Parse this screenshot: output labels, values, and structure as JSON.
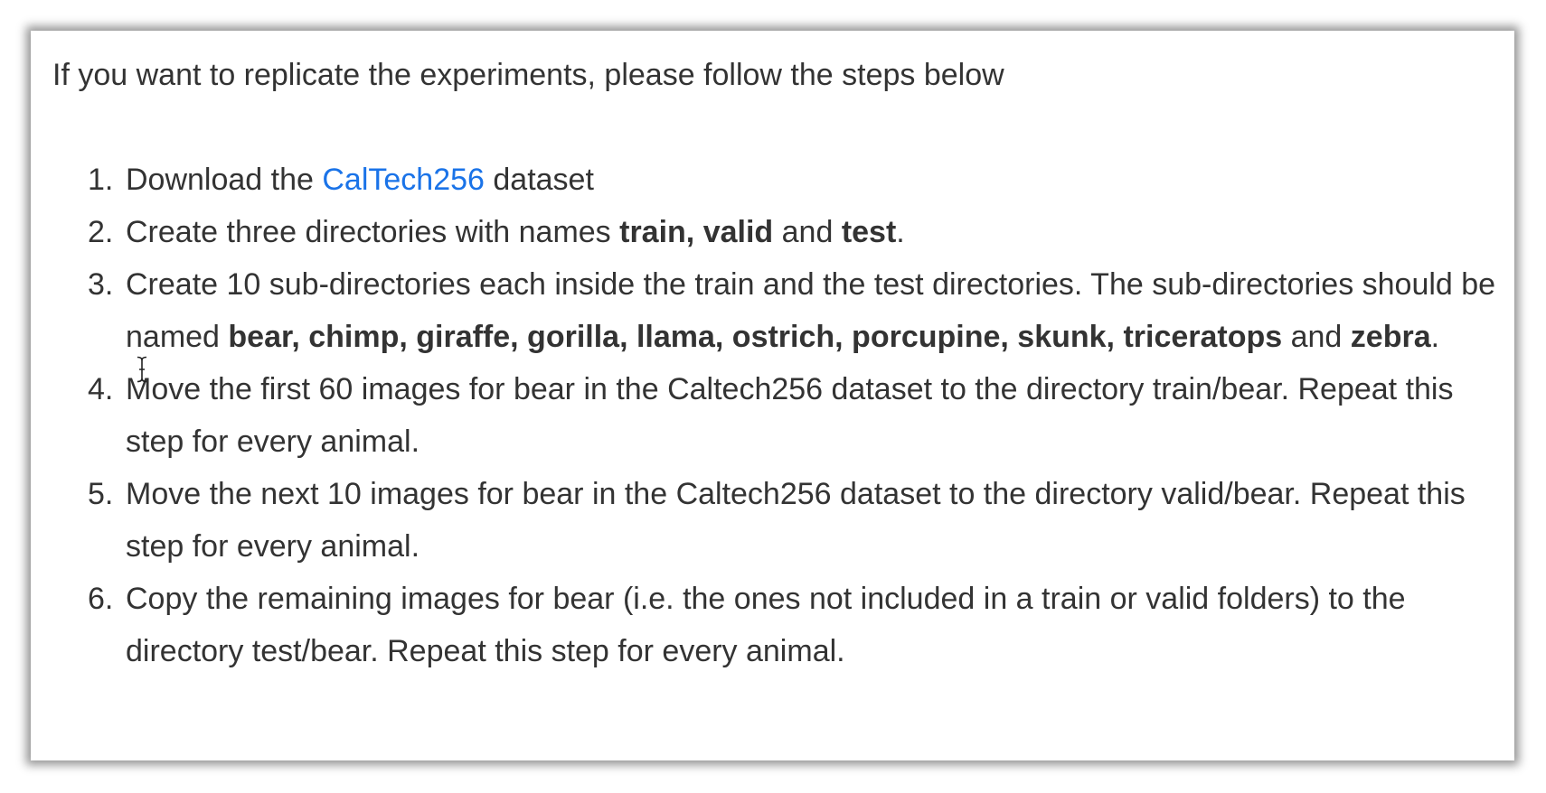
{
  "intro": "If you want to replicate the experiments, please follow the steps below",
  "steps": [
    {
      "number": "1.",
      "t1": "Download the ",
      "link": "CalTech256",
      "t2": " dataset"
    },
    {
      "number": "2.",
      "t1": "Create three directories with names ",
      "b1": "train, valid",
      "t2": " and ",
      "b2": "test",
      "t3": "."
    },
    {
      "number": "3.",
      "t1": "Create 10 sub-directories each inside the train and the test directories. The sub-directories should be named ",
      "b1": "bear, chimp, giraffe, gorilla, llama, ostrich, porcupine, skunk, triceratops",
      "t2": " and ",
      "b2": "zebra",
      "t3": "."
    },
    {
      "number": "4.",
      "text": "Move the first 60 images for bear in the Caltech256 dataset to the directory train/bear. Repeat this step for every animal."
    },
    {
      "number": "5.",
      "text": "Move the next 10 images for bear in the Caltech256 dataset to the directory valid/bear. Repeat this step for every animal."
    },
    {
      "number": "6.",
      "text": "Copy the remaining images for bear (i.e. the ones not included in a train or valid folders) to the directory test/bear. Repeat this step for every animal."
    }
  ],
  "colors": {
    "text": "#333333",
    "link": "#1a73e8"
  },
  "cursor_icon": "text-cursor-icon"
}
